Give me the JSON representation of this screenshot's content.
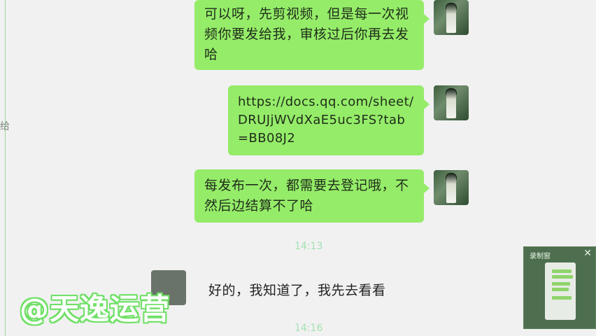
{
  "left_edge_glyph": "给",
  "messages": [
    {
      "text": "可以呀，先剪视频，但是每一次视频你要发给我，审核过后你再去发哈"
    },
    {
      "text": "https://docs.qq.com/sheet/DRUJjWVdXaE5uc3FS?tab=BB08J2"
    },
    {
      "text": "每发布一次，都需要去登记哦，不然后边结算不了哈"
    }
  ],
  "time_1": "14:13",
  "reply": "好的，我知道了，我先去看看",
  "time_2": "14:16",
  "watermark": "@天逸运营",
  "mini_window": {
    "title": "录制窗",
    "close": "✕"
  }
}
